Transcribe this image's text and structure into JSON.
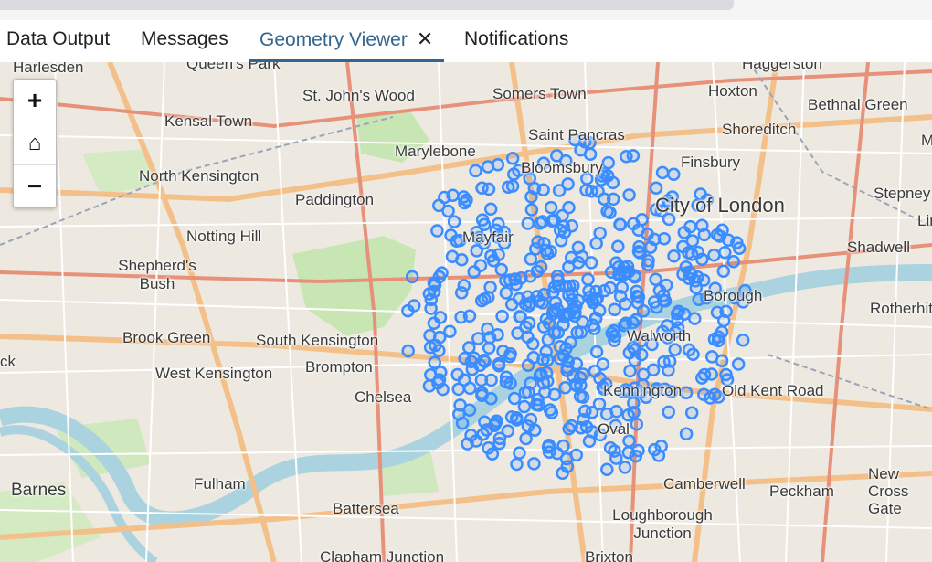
{
  "tabs": [
    {
      "label": "Data Output"
    },
    {
      "label": "Messages"
    },
    {
      "label": "Geometry Viewer",
      "close": "✕"
    },
    {
      "label": "Notifications"
    }
  ],
  "zoom": {
    "in": "+",
    "home": "⌂",
    "out": "−"
  },
  "map": {
    "labels": [
      "Harlesden",
      "Queen's Park",
      "Haggerston",
      "St. John's Wood",
      "Somers Town",
      "Hoxton",
      "Bethnal Green",
      "Kensal Town",
      "Marylebone",
      "Saint Pancras",
      "Shoreditch",
      "North Kensington",
      "Bloomsbury",
      "Finsbury",
      "Paddington",
      "City of London",
      "Stepney",
      "Notting Hill",
      "Mayfair",
      "Shadwell",
      "Shepherd's Bush",
      "Borough",
      "Rotherhithe",
      "Brook Green",
      "South Kensington",
      "Walworth",
      "West Kensington",
      "Brompton",
      "Kennington",
      "Old Kent Road",
      "Chelsea",
      "Oval",
      "Barnes",
      "Fulham",
      "Camberwell",
      "Peckham",
      "New Cross Gate",
      "Battersea",
      "Loughborough Junction",
      "Clapham Junction",
      "Brixton",
      "Lim",
      "M",
      "ck"
    ],
    "point_color": "#3b8cff"
  }
}
